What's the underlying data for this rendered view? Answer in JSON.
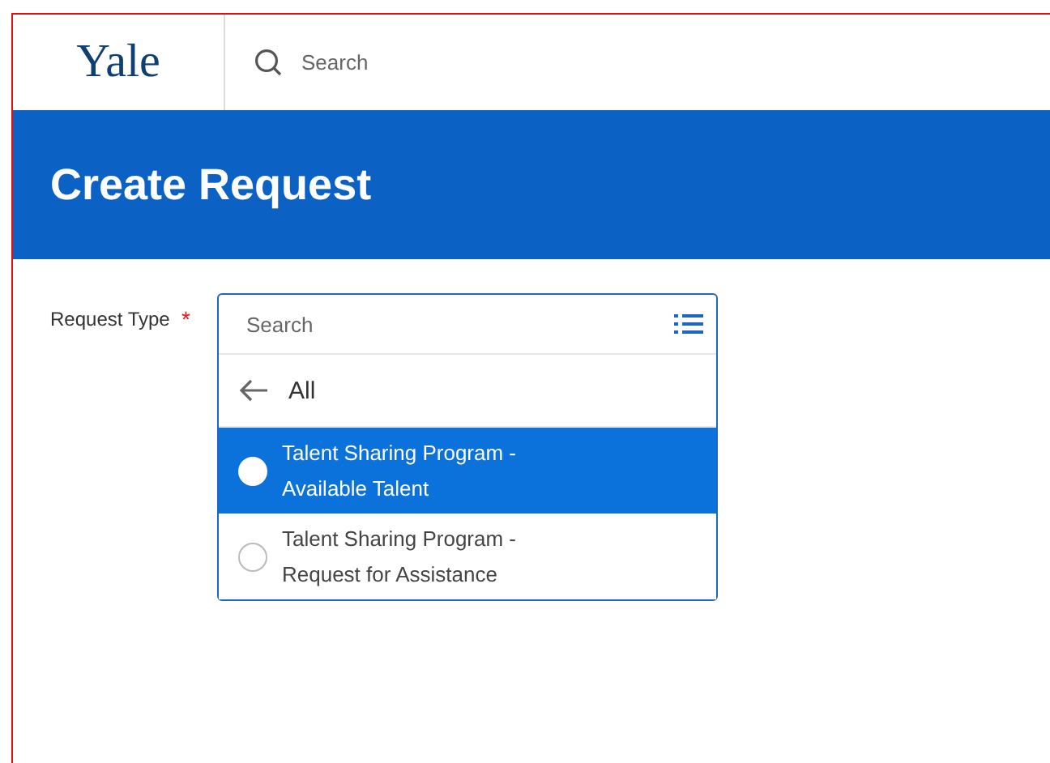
{
  "header": {
    "logo": "Yale",
    "search": {
      "placeholder": "Search"
    }
  },
  "title": "Create Request",
  "field": {
    "label": "Request Type",
    "required_mark": "*",
    "dropdown": {
      "search": {
        "placeholder": "Search"
      },
      "back_label": "All",
      "options": [
        {
          "lines": [
            "Talent Sharing Program -",
            "Available Talent"
          ],
          "selected": true
        },
        {
          "lines": [
            "Talent Sharing Program -",
            "Request for Assistance"
          ],
          "selected": false
        }
      ]
    }
  }
}
